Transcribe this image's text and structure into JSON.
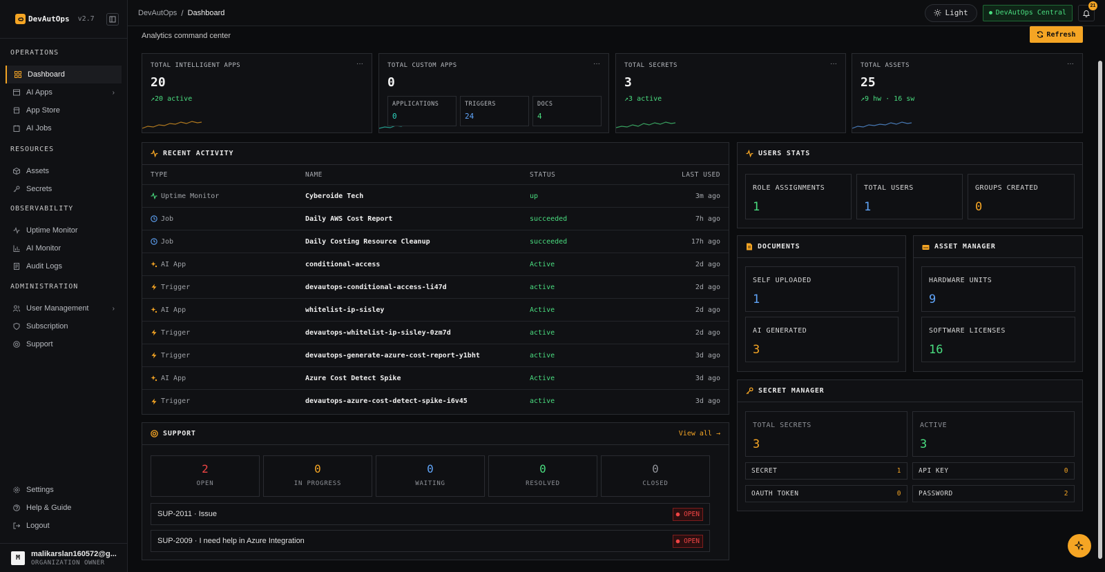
{
  "brand": {
    "name": "DevAutOps",
    "version": "v2.7"
  },
  "sidebar": {
    "sections": [
      {
        "title": "OPERATIONS",
        "items": [
          {
            "label": "Dashboard",
            "icon": "grid-icon",
            "active": true
          },
          {
            "label": "AI Apps",
            "icon": "window-icon",
            "chevron": true
          },
          {
            "label": "App Store",
            "icon": "store-icon"
          },
          {
            "label": "AI Jobs",
            "icon": "calendar-icon"
          }
        ]
      },
      {
        "title": "RESOURCES",
        "items": [
          {
            "label": "Assets",
            "icon": "cube-icon"
          },
          {
            "label": "Secrets",
            "icon": "key-icon"
          }
        ]
      },
      {
        "title": "OBSERVABILITY",
        "items": [
          {
            "label": "Uptime Monitor",
            "icon": "pulse-icon"
          },
          {
            "label": "AI Monitor",
            "icon": "bar-chart-icon"
          },
          {
            "label": "Audit Logs",
            "icon": "log-icon"
          }
        ]
      },
      {
        "title": "ADMINISTRATION",
        "items": [
          {
            "label": "User Management",
            "icon": "users-icon",
            "chevron": true
          },
          {
            "label": "Subscription",
            "icon": "shield-icon"
          },
          {
            "label": "Support",
            "icon": "lifebuoy-icon"
          }
        ]
      }
    ],
    "footer_items": [
      {
        "label": "Settings",
        "icon": "gear-icon"
      },
      {
        "label": "Help & Guide",
        "icon": "help-icon"
      },
      {
        "label": "Logout",
        "icon": "logout-icon"
      }
    ],
    "user": {
      "initial": "M",
      "email": "malikarslan160572@g...",
      "role": "ORGANIZATION OWNER"
    }
  },
  "topbar": {
    "breadcrumb_root": "DevAutOps",
    "breadcrumb_sep": "/",
    "breadcrumb_current": "Dashboard",
    "theme_label": "Light",
    "env_label": "DevAutOps Central",
    "notification_count": "21"
  },
  "page": {
    "subtitle": "Analytics command center",
    "refresh_label": "Refresh"
  },
  "kpis": {
    "intelligent": {
      "title": "TOTAL INTELLIGENT APPS",
      "value": "20",
      "trend": "20 active",
      "menu": "···"
    },
    "custom": {
      "title": "TOTAL CUSTOM APPS",
      "value": "0",
      "menu": "···",
      "mini": [
        {
          "label": "APPLICATIONS",
          "value": "0"
        },
        {
          "label": "TRIGGERS",
          "value": "24"
        },
        {
          "label": "DOCS",
          "value": "4"
        }
      ]
    },
    "secrets": {
      "title": "TOTAL SECRETS",
      "value": "3",
      "trend": "3 active",
      "menu": "···"
    },
    "assets": {
      "title": "TOTAL ASSETS",
      "value": "25",
      "trend": "9 hw · 16 sw",
      "menu": "···"
    }
  },
  "activity": {
    "title": "RECENT ACTIVITY",
    "columns": {
      "type": "TYPE",
      "name": "NAME",
      "status": "STATUS",
      "last": "LAST USED"
    },
    "rows": [
      {
        "type": "Uptime Monitor",
        "icon": "pulse-icon",
        "name": "Cyberoide Tech",
        "status": "up",
        "last": "3m ago"
      },
      {
        "type": "Job",
        "icon": "clock-icon",
        "name": "Daily AWS Cost Report",
        "status": "succeeded",
        "last": "7h ago"
      },
      {
        "type": "Job",
        "icon": "clock-icon",
        "name": "Daily Costing Resource Cleanup",
        "status": "succeeded",
        "last": "17h ago"
      },
      {
        "type": "AI App",
        "icon": "sparkle-icon",
        "name": "conditional-access",
        "status": "Active",
        "last": "2d ago"
      },
      {
        "type": "Trigger",
        "icon": "bolt-icon",
        "name": "devautops-conditional-access-li47d",
        "status": "active",
        "last": "2d ago"
      },
      {
        "type": "AI App",
        "icon": "sparkle-icon",
        "name": "whitelist-ip-sisley",
        "status": "Active",
        "last": "2d ago"
      },
      {
        "type": "Trigger",
        "icon": "bolt-icon",
        "name": "devautops-whitelist-ip-sisley-0zm7d",
        "status": "active",
        "last": "2d ago"
      },
      {
        "type": "Trigger",
        "icon": "bolt-icon",
        "name": "devautops-generate-azure-cost-report-y1bht",
        "status": "active",
        "last": "3d ago"
      },
      {
        "type": "AI App",
        "icon": "sparkle-icon",
        "name": "Azure Cost Detect Spike",
        "status": "Active",
        "last": "3d ago"
      },
      {
        "type": "Trigger",
        "icon": "bolt-icon",
        "name": "devautops-azure-cost-detect-spike-i6v45",
        "status": "active",
        "last": "3d ago"
      }
    ]
  },
  "support": {
    "title": "SUPPORT",
    "view_all": "View all →",
    "cards": [
      {
        "value": "2",
        "label": "OPEN",
        "color": "#ef4444"
      },
      {
        "value": "0",
        "label": "IN PROGRESS",
        "color": "#f5a524"
      },
      {
        "value": "0",
        "label": "WAITING",
        "color": "#60a5fa"
      },
      {
        "value": "0",
        "label": "RESOLVED",
        "color": "#4ade80"
      },
      {
        "value": "0",
        "label": "CLOSED",
        "color": "#8f9298"
      }
    ],
    "tickets": [
      {
        "title": "SUP-2011 · Issue",
        "badge": "OPEN"
      },
      {
        "title": "SUP-2009 · I need help in Azure Integration",
        "badge": "OPEN"
      }
    ]
  },
  "users_stats": {
    "title": "USERS STATS",
    "role_assignments": {
      "label": "ROLE ASSIGNMENTS",
      "value": "1"
    },
    "total_users": {
      "label": "TOTAL USERS",
      "value": "1"
    },
    "groups_created": {
      "label": "GROUPS CREATED",
      "value": "0"
    }
  },
  "documents": {
    "title": "DOCUMENTS",
    "self_uploaded": {
      "label": "SELF UPLOADED",
      "value": "1"
    },
    "ai_generated": {
      "label": "AI GENERATED",
      "value": "3"
    }
  },
  "asset_manager": {
    "title": "ASSET MANAGER",
    "hardware": {
      "label": "HARDWARE UNITS",
      "value": "9"
    },
    "software": {
      "label": "SOFTWARE LICENSES",
      "value": "16"
    }
  },
  "secret_manager": {
    "title": "SECRET MANAGER",
    "total": {
      "label": "TOTAL SECRETS",
      "value": "3"
    },
    "active": {
      "label": "ACTIVE",
      "value": "3"
    },
    "secret": {
      "label": "SECRET",
      "value": "1"
    },
    "api_key": {
      "label": "API KEY",
      "value": "0"
    },
    "oauth": {
      "label": "OAUTH TOKEN",
      "value": "0"
    },
    "password": {
      "label": "PASSWORD",
      "value": "2"
    }
  },
  "colors": {
    "accent": "#f5a524",
    "green": "#4ade80",
    "blue": "#60a5fa",
    "red": "#ef4444",
    "teal": "#2dd4bf"
  }
}
